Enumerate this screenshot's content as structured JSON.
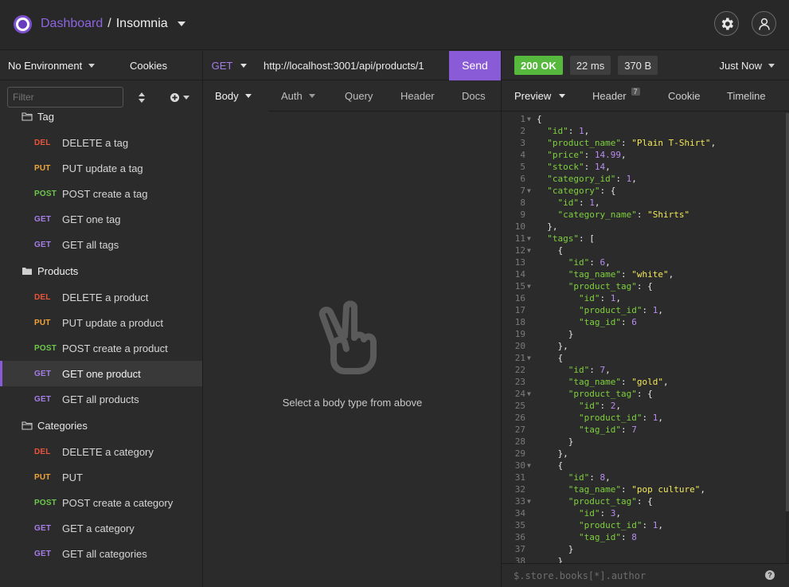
{
  "header": {
    "dashboard_label": "Dashboard",
    "separator": "/",
    "project_name": "Insomnia",
    "icons": [
      "logo-icon",
      "gear-icon",
      "user-icon"
    ]
  },
  "sidebar": {
    "environment": "No Environment",
    "cookies_label": "Cookies",
    "filter_placeholder": "Filter",
    "groups": [
      {
        "name": "Tag",
        "open": false,
        "requests": [
          {
            "method": "DEL",
            "label": "DELETE a tag"
          },
          {
            "method": "PUT",
            "label": "PUT update a tag"
          },
          {
            "method": "POST",
            "label": "POST create a tag"
          },
          {
            "method": "GET",
            "label": "GET one tag"
          },
          {
            "method": "GET",
            "label": "GET all tags"
          }
        ]
      },
      {
        "name": "Products",
        "open": true,
        "requests": [
          {
            "method": "DEL",
            "label": "DELETE a product"
          },
          {
            "method": "PUT",
            "label": "PUT update a product"
          },
          {
            "method": "POST",
            "label": "POST create a product"
          },
          {
            "method": "GET",
            "label": "GET one product",
            "active": true
          },
          {
            "method": "GET",
            "label": "GET all products"
          }
        ]
      },
      {
        "name": "Categories",
        "open": false,
        "requests": [
          {
            "method": "DEL",
            "label": "DELETE a category"
          },
          {
            "method": "PUT",
            "label": "PUT"
          },
          {
            "method": "POST",
            "label": "POST create a category"
          },
          {
            "method": "GET",
            "label": "GET a category"
          },
          {
            "method": "GET",
            "label": "GET all categories"
          }
        ]
      }
    ]
  },
  "request": {
    "method": "GET",
    "url": "http://localhost:3001/api/products/1",
    "send_label": "Send",
    "tabs": [
      "Body",
      "Auth",
      "Query",
      "Header",
      "Docs"
    ],
    "empty_message": "Select a body type from above"
  },
  "response": {
    "status": "200 OK",
    "time": "22 ms",
    "size": "370 B",
    "when": "Just Now",
    "tabs": [
      "Preview",
      "Header",
      "Cookie",
      "Timeline"
    ],
    "header_count": "7",
    "filter_placeholder": "$.store.books[*].author",
    "help_label": "?",
    "lines": [
      "{",
      "  \"id\": 1,",
      "  \"product_name\": \"Plain T-Shirt\",",
      "  \"price\": 14.99,",
      "  \"stock\": 14,",
      "  \"category_id\": 1,",
      "  \"category\": {",
      "    \"id\": 1,",
      "    \"category_name\": \"Shirts\"",
      "  },",
      "  \"tags\": [",
      "    {",
      "      \"id\": 6,",
      "      \"tag_name\": \"white\",",
      "      \"product_tag\": {",
      "        \"id\": 1,",
      "        \"product_id\": 1,",
      "        \"tag_id\": 6",
      "      }",
      "    },",
      "    {",
      "      \"id\": 7,",
      "      \"tag_name\": \"gold\",",
      "      \"product_tag\": {",
      "        \"id\": 2,",
      "        \"product_id\": 1,",
      "        \"tag_id\": 7",
      "      }",
      "    },",
      "    {",
      "      \"id\": 8,",
      "      \"tag_name\": \"pop culture\",",
      "      \"product_tag\": {",
      "        \"id\": 3,",
      "        \"product_id\": 1,",
      "        \"tag_id\": 8",
      "      }",
      "    }"
    ],
    "fold_lines": [
      1,
      7,
      11,
      12,
      15,
      21,
      24,
      30,
      33
    ]
  },
  "colors": {
    "accent": "#8a5bd6",
    "status_ok": "#56b83c",
    "method_del": "#e8543c",
    "method_put": "#f0a43a",
    "method_post": "#6ec84c",
    "method_get": "#a57ee6"
  }
}
